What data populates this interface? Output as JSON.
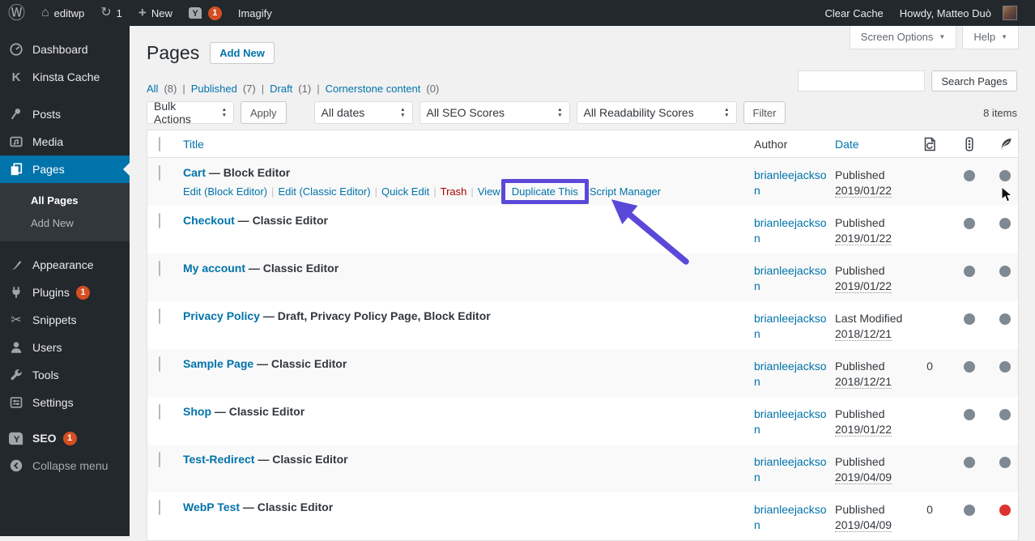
{
  "misc": {
    "separator": "|"
  },
  "colors": {
    "accent_blue": "#0073aa",
    "badge_red": "#d54e21",
    "annotation_purple": "#5a49d8",
    "dot_gray": "#7e8993",
    "dot_red": "#dc3232"
  },
  "admin_bar": {
    "icons": [
      "wordpress-logo-icon",
      "home-icon",
      "updates-icon",
      "plus-icon",
      "yoast-icon"
    ],
    "site_name": "editwp",
    "update_count": "1",
    "new_label": "New",
    "yoast_notification_count": "1",
    "imagify_label": "Imagify",
    "clear_cache_label": "Clear Cache",
    "howdy_text": "Howdy, Matteo Duò"
  },
  "sidebar": {
    "items": [
      {
        "label": "Dashboard",
        "icon": "dashboard-icon"
      },
      {
        "label": "Kinsta Cache",
        "icon": "kinsta-icon"
      },
      {
        "label": "Posts",
        "icon": "pushpin-icon"
      },
      {
        "label": "Media",
        "icon": "media-icon"
      },
      {
        "label": "Pages",
        "icon": "pages-icon"
      },
      {
        "label": "Appearance",
        "icon": "appearance-brush-icon"
      },
      {
        "label": "Plugins",
        "icon": "plugin-icon",
        "badge": "1"
      },
      {
        "label": "Snippets",
        "icon": "scissors-icon"
      },
      {
        "label": "Users",
        "icon": "user-icon"
      },
      {
        "label": "Tools",
        "icon": "wrench-icon"
      },
      {
        "label": "Settings",
        "icon": "settings-icon"
      },
      {
        "label": "SEO",
        "icon": "yoast-icon",
        "badge": "1"
      },
      {
        "label": "Collapse menu",
        "icon": "collapse-icon"
      }
    ],
    "submenu": [
      {
        "label": "All Pages",
        "current": true
      },
      {
        "label": "Add New",
        "current": false
      }
    ]
  },
  "header": {
    "page_title": "Pages",
    "add_new": "Add New",
    "screen_options": "Screen Options",
    "help": "Help"
  },
  "search": {
    "value": "",
    "button": "Search Pages"
  },
  "views": [
    {
      "label": "All",
      "count": "(8)"
    },
    {
      "label": "Published",
      "count": "(7)"
    },
    {
      "label": "Draft",
      "count": "(1)"
    },
    {
      "label": "Cornerstone content",
      "count": "(0)"
    }
  ],
  "toolbar": {
    "bulk_actions": "Bulk Actions",
    "apply": "Apply",
    "dates": "All dates",
    "seo_scores": "All SEO Scores",
    "readability_scores": "All Readability Scores",
    "filter": "Filter",
    "items_count": "8 items"
  },
  "table": {
    "columns": {
      "title": "Title",
      "author": "Author",
      "date": "Date"
    },
    "column_icons": [
      "page-redirect-icon",
      "seo-score-traffic-light-icon",
      "readability-quill-icon"
    ],
    "rows": [
      {
        "title": "Cart",
        "state": "— Block Editor",
        "author": "brianleejackson",
        "status": "Published",
        "date": "2019/01/22",
        "links": "",
        "seo": "gray",
        "readability": "gray",
        "actions": [
          {
            "label": "Edit (Block Editor)"
          },
          {
            "label": "Edit (Classic Editor)"
          },
          {
            "label": "Quick Edit"
          },
          {
            "label": "Trash",
            "danger": true
          },
          {
            "label": "View"
          },
          {
            "label": "Duplicate This",
            "highlighted": true
          },
          {
            "label": "Script Manager"
          }
        ]
      },
      {
        "title": "Checkout",
        "state": "— Classic Editor",
        "author": "brianleejackson",
        "status": "Published",
        "date": "2019/01/22",
        "links": "",
        "seo": "gray",
        "readability": "gray"
      },
      {
        "title": "My account",
        "state": "— Classic Editor",
        "author": "brianleejackson",
        "status": "Published",
        "date": "2019/01/22",
        "links": "",
        "seo": "gray",
        "readability": "gray"
      },
      {
        "title": "Privacy Policy",
        "state": "— Draft, Privacy Policy Page, Block Editor",
        "author": "brianleejackson",
        "status": "Last Modified",
        "date": "2018/12/21",
        "links": "",
        "seo": "gray",
        "readability": "gray"
      },
      {
        "title": "Sample Page",
        "state": "— Classic Editor",
        "author": "brianleejackson",
        "status": "Published",
        "date": "2018/12/21",
        "links": "0",
        "seo": "gray",
        "readability": "gray"
      },
      {
        "title": "Shop",
        "state": "— Classic Editor",
        "author": "brianleejackson",
        "status": "Published",
        "date": "2019/01/22",
        "links": "",
        "seo": "gray",
        "readability": "gray"
      },
      {
        "title": "Test-Redirect",
        "state": "— Classic Editor",
        "author": "brianleejackson",
        "status": "Published",
        "date": "2019/04/09",
        "links": "",
        "seo": "gray",
        "readability": "gray"
      },
      {
        "title": "WebP Test",
        "state": "— Classic Editor",
        "author": "brianleejackson",
        "status": "Published",
        "date": "2019/04/09",
        "links": "0",
        "seo": "gray",
        "readability": "red"
      }
    ]
  }
}
